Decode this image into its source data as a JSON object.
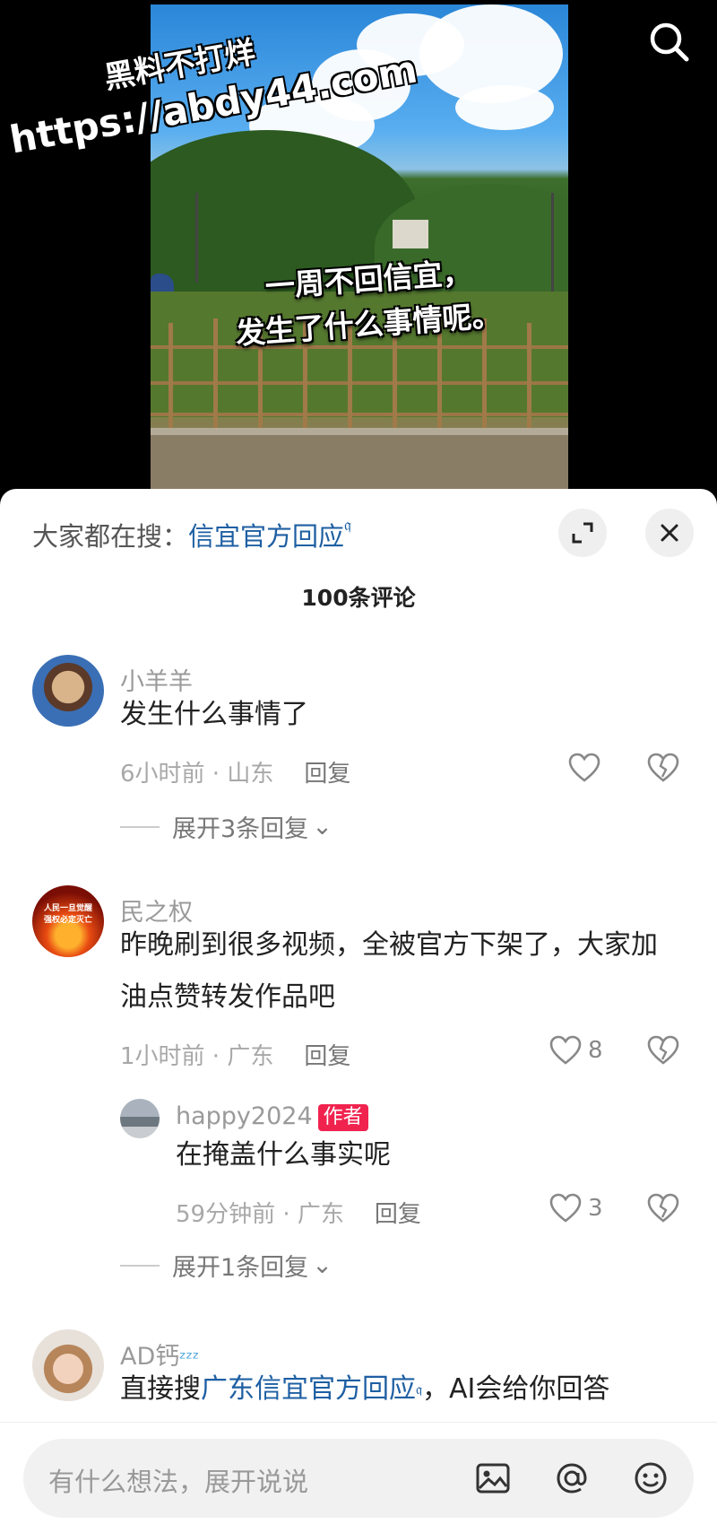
{
  "video": {
    "caption_line1": "一周不回信宜，",
    "caption_line2": "发生了什么事情呢。",
    "watermark_title": "黑料不打烊",
    "watermark_url": "https://abdy44.com"
  },
  "sheet": {
    "trending_prefix": "大家都在搜：",
    "trending_query": "信宜官方回应",
    "comment_count": "100条评论"
  },
  "comments": [
    {
      "user": "小羊羊",
      "text": "发生什么事情了",
      "time_location": "6小时前 · 山东",
      "reply": "回复",
      "likes": "",
      "expand": "展开3条回复"
    },
    {
      "user": "民之权",
      "avatar_text": "人民一旦觉醒 强权必定灭亡",
      "text": "昨晚刷到很多视频，全被官方下架了，大家加油点赞转发作品吧",
      "time_location": "1小时前 · 广东",
      "reply": "回复",
      "likes": "8",
      "sub_reply": {
        "user": "happy2024",
        "badge": "作者",
        "text": "在掩盖什么事实呢",
        "time_location": "59分钟前 · 广东",
        "reply": "回复",
        "likes": "3"
      },
      "expand": "展开1条回复"
    },
    {
      "user": "AD钙",
      "user_suffix": "ᶻᶻᶻ",
      "text_prefix": "直接搜",
      "text_link": "广东信宜官方回应",
      "text_suffix": "，AI会给你回答"
    }
  ],
  "input": {
    "placeholder": "有什么想法，展开说说"
  },
  "icons": {
    "search": "search-icon",
    "expand": "expand-icon",
    "close": "close-icon",
    "like": "heart-icon",
    "dislike": "broken-heart-icon",
    "image": "image-icon",
    "mention": "at-icon",
    "emoji": "emoji-icon"
  },
  "colors": {
    "link": "#1e5fa3",
    "author_badge": "#f0234f"
  }
}
